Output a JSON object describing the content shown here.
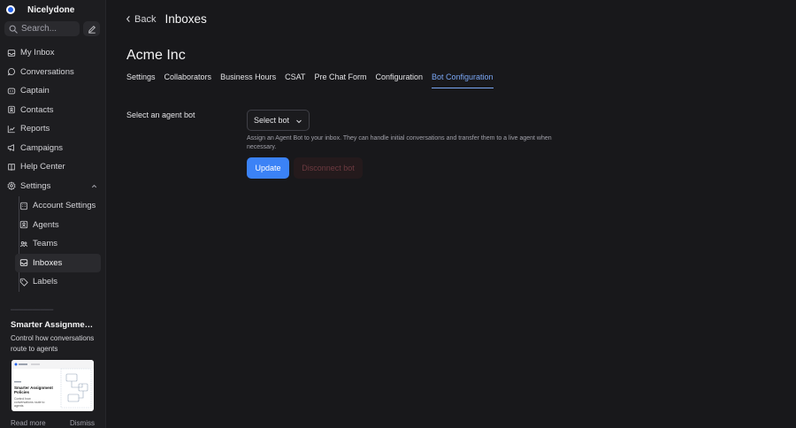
{
  "app": {
    "name": "Nicelydone"
  },
  "search": {
    "placeholder": "Search..."
  },
  "nav": {
    "items": [
      {
        "label": "My Inbox",
        "icon": "inbox-icon"
      },
      {
        "label": "Conversations",
        "icon": "chat-icon"
      },
      {
        "label": "Captain",
        "icon": "captain-icon"
      },
      {
        "label": "Contacts",
        "icon": "contacts-icon"
      },
      {
        "label": "Reports",
        "icon": "chart-icon"
      },
      {
        "label": "Campaigns",
        "icon": "megaphone-icon"
      },
      {
        "label": "Help Center",
        "icon": "book-icon"
      },
      {
        "label": "Settings",
        "icon": "gear-icon",
        "expanded": true
      }
    ],
    "settings_children": [
      {
        "label": "Account Settings",
        "icon": "building-icon"
      },
      {
        "label": "Agents",
        "icon": "agent-icon"
      },
      {
        "label": "Teams",
        "icon": "teams-icon"
      },
      {
        "label": "Inboxes",
        "icon": "inbox-tray-icon",
        "active": true
      },
      {
        "label": "Labels",
        "icon": "tag-icon"
      }
    ]
  },
  "promo": {
    "title": "Smarter Assignment Policies",
    "description": "Control how conversations route to agents",
    "card_title": "Smarter Assignment Policies",
    "card_description": "Control how conversations route to agents",
    "read_more": "Read more",
    "dismiss": "Dismiss"
  },
  "header": {
    "back_label": "Back",
    "title": "Inboxes"
  },
  "inbox": {
    "name": "Acme Inc"
  },
  "tabs": [
    {
      "label": "Settings"
    },
    {
      "label": "Collaborators"
    },
    {
      "label": "Business Hours"
    },
    {
      "label": "CSAT"
    },
    {
      "label": "Pre Chat Form"
    },
    {
      "label": "Configuration"
    },
    {
      "label": "Bot Configuration",
      "active": true
    }
  ],
  "bot_config": {
    "field_label": "Select an agent bot",
    "select_value": "Select bot",
    "help_text": "Assign an Agent Bot to your inbox. They can handle initial conversations and transfer them to a live agent when necessary.",
    "update_label": "Update",
    "disconnect_label": "Disconnect bot"
  },
  "colors": {
    "background": "#18181b",
    "sidebar": "#1d1d20",
    "accent": "#3b82f6",
    "active_tab": "#7aa7f5",
    "danger_muted": "#6d3a40"
  }
}
